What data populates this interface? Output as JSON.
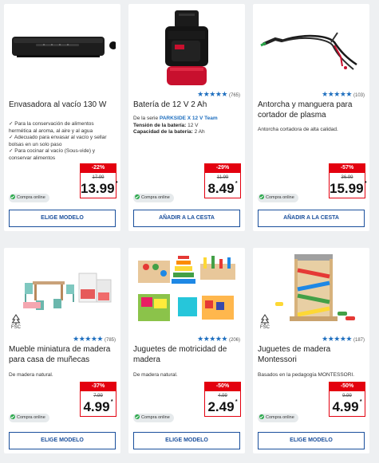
{
  "products": [
    {
      "title": "Envasadora al vacío 130 W",
      "features": [
        "✓ Para la conservación de alimentos hermética al aroma, al aire y al agua",
        "✓ Adecuado para envasar al vacío y sellar bolsas en un solo paso",
        "✓ Para cocinar al vacío (Sous-vide) y conservar alimentos"
      ],
      "online_label": "Compra online",
      "discount": "-22%",
      "old_price": "17.99",
      "price": "13.99",
      "price_mark": "*",
      "button_label": "ELIGE MODELO"
    },
    {
      "title": "Batería de 12 V 2 Ah",
      "rating_count": "(765)",
      "rating_stars": 5,
      "series_prefix": "De la serie ",
      "series_name": "PARKSIDE X 12 V Team",
      "spec1_label": "Tensión de la batería:",
      "spec1_value": " 12 V",
      "spec2_label": "Capacidad de la batería:",
      "spec2_value": " 2 Ah",
      "online_label": "Compra online",
      "discount": "-29%",
      "old_price": "11.99",
      "price": "8.49",
      "price_mark": "*",
      "button_label": "AÑADIR A LA CESTA"
    },
    {
      "title": "Antorcha y manguera para cortador de plasma",
      "rating_count": "(103)",
      "rating_stars": 5,
      "description": "Antorcha cortadora de alta calidad.",
      "online_label": "Compra online",
      "discount": "-57%",
      "old_price": "36.99",
      "price": "15.99",
      "price_mark": "*",
      "button_label": "AÑADIR A LA CESTA"
    },
    {
      "title": "Mueble miniatura de madera para casa de muñecas",
      "rating_count": "(785)",
      "rating_stars": 5,
      "fsc": "FSC",
      "description": "De madera natural.",
      "online_label": "Compra online",
      "discount": "-37%",
      "old_price": "7.99",
      "price": "4.99",
      "price_mark": "*",
      "button_label": "ELIGE MODELO"
    },
    {
      "title": "Juguetes de motricidad de madera",
      "rating_count": "(206)",
      "rating_stars": 5,
      "description": "De madera natural.",
      "online_label": "Compra online",
      "discount": "-50%",
      "old_price": "4.99",
      "price": "2.49",
      "price_mark": "*",
      "button_label": "ELIGE MODELO"
    },
    {
      "title": "Juguetes de madera Montessori",
      "rating_count": "(187)",
      "rating_stars": 5,
      "fsc": "FSC",
      "description": "Basados en la pedagogía MONTESSORI.",
      "online_label": "Compra online",
      "discount": "-50%",
      "old_price": "9.99",
      "price": "4.99",
      "price_mark": "*",
      "button_label": "ELIGE MODELO"
    }
  ],
  "colors": {
    "accent_blue": "#1a4f9c",
    "sale_red": "#e3000f",
    "online_green": "#2aa84a",
    "star_blue": "#1f6fbf"
  }
}
